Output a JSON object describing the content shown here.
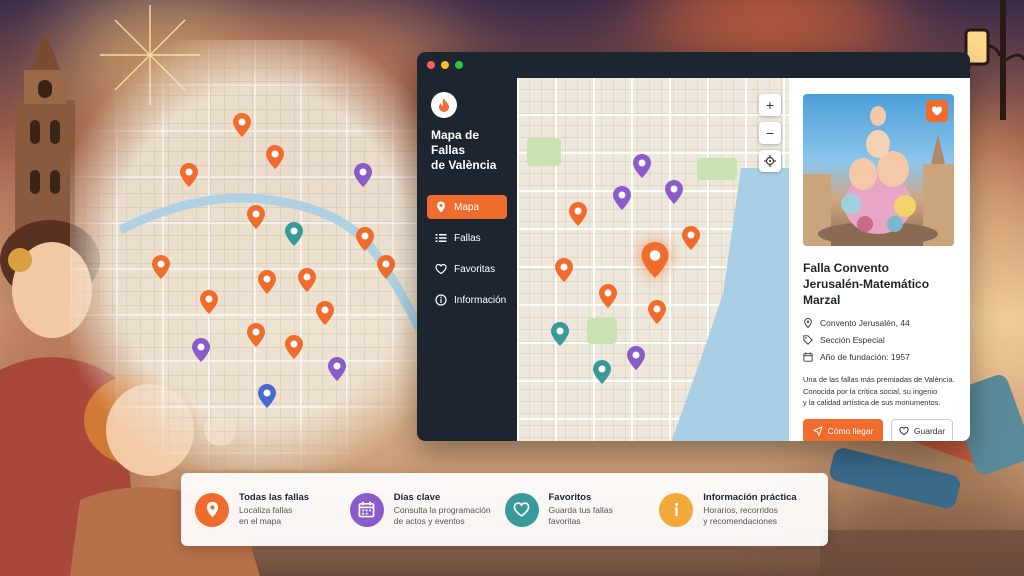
{
  "colors": {
    "accent": "#ef6c2d",
    "dark": "#1d2530",
    "purple": "#8a5cc9",
    "teal": "#3a9a9a",
    "blue": "#4a6ad0",
    "yellow": "#f3a83a"
  },
  "app": {
    "title_line1": "Mapa de Fallas",
    "title_line2": "de València"
  },
  "sidebar": {
    "items": [
      {
        "label": "Mapa",
        "icon": "map-pin-icon"
      },
      {
        "label": "Fallas",
        "icon": "list-icon"
      },
      {
        "label": "Favoritas",
        "icon": "heart-icon"
      },
      {
        "label": "Información",
        "icon": "info-icon"
      }
    ]
  },
  "map": {
    "zoom_in": "+",
    "zoom_out": "−"
  },
  "detail": {
    "name_line1": "Falla Convento",
    "name_line2": "Jerusalén-Matemático Marzal",
    "address": "Convento Jerusalén, 44",
    "section": "Sección Especial",
    "founded": "Año de fundación: 1957",
    "description_line1": "Una de las fallas más premiadas de València.",
    "description_line2": "Conocida por la crítica social, su ingenio",
    "description_line3": "y la calidad artística de sus monumentos.",
    "primary_button": "Cómo llegar",
    "secondary_button": "Guardar"
  },
  "features": [
    {
      "title": "Todas las fallas",
      "line1": "Localiza fallas",
      "line2": "en el mapa",
      "icon": "map-pin-icon"
    },
    {
      "title": "Días clave",
      "line1": "Consulta la programación",
      "line2": "de actos y eventos",
      "icon": "calendar-icon"
    },
    {
      "title": "Favoritos",
      "line1": "Guarda tus fallas",
      "line2": "favoritas",
      "icon": "heart-icon"
    },
    {
      "title": "Información práctica",
      "line1": "Horarios, recorridos",
      "line2": "y recomendaciones",
      "icon": "info-icon"
    }
  ]
}
